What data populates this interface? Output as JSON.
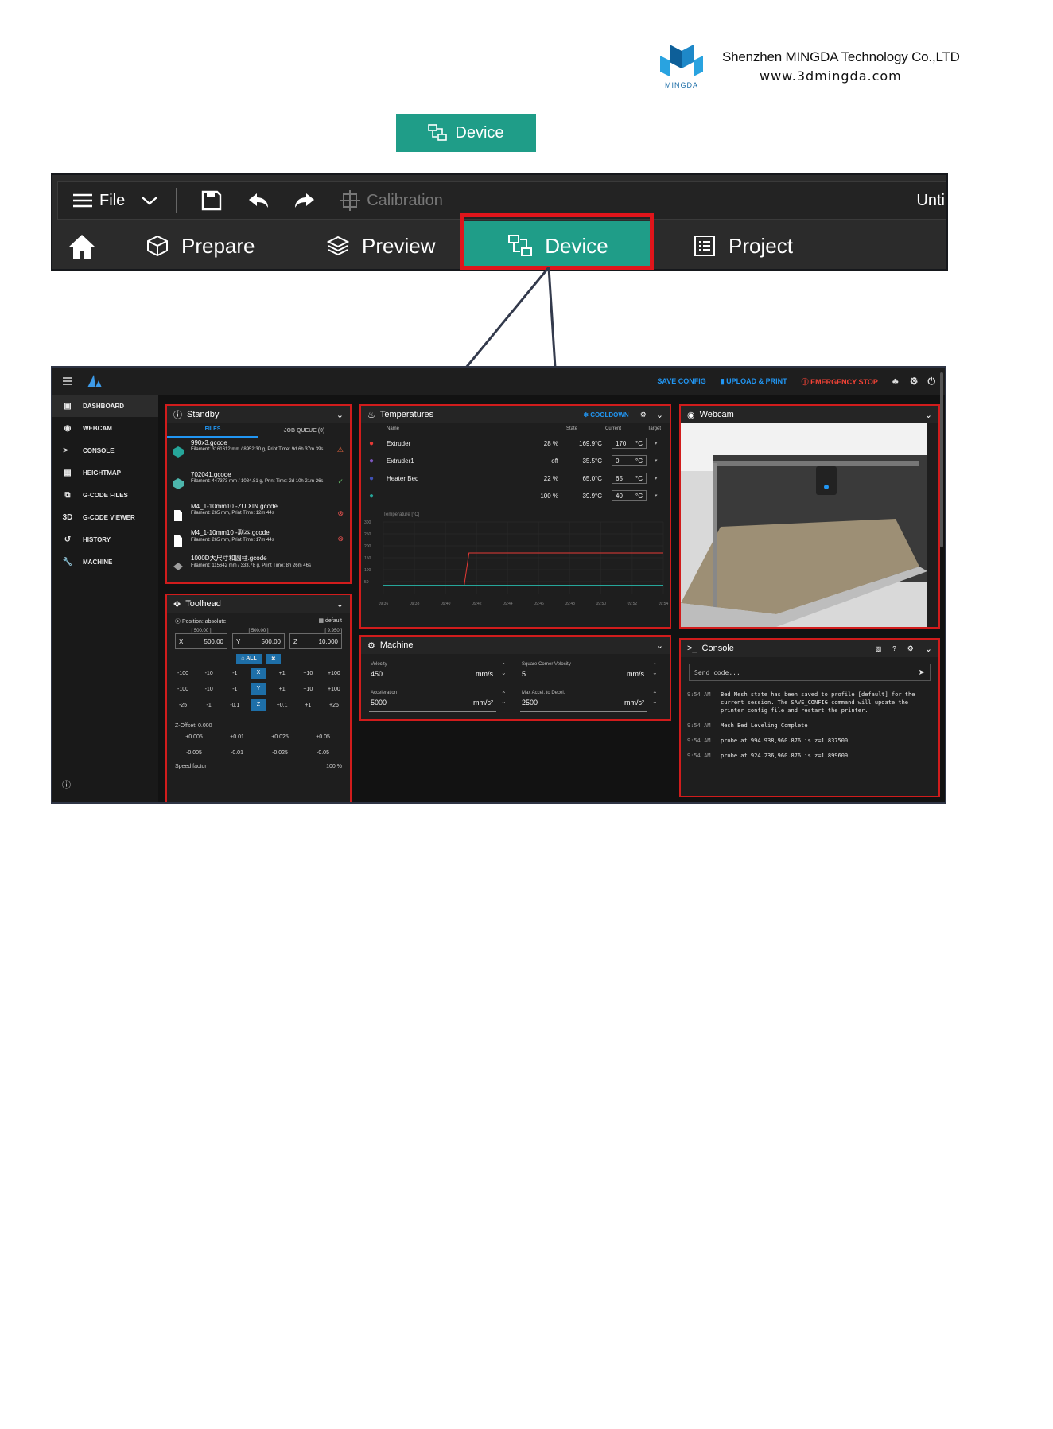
{
  "header": {
    "company_name": "Shenzhen MINGDA Technology Co.,LTD",
    "website": "www.3dmingda.com",
    "logo_text": "MINGDA"
  },
  "device_chip": {
    "label": "Device"
  },
  "toolbar": {
    "file_label": "File",
    "calibration_label": "Calibration",
    "title_fragment": "Unti",
    "tabs": [
      {
        "label": "Prepare"
      },
      {
        "label": "Preview"
      },
      {
        "label": "Device"
      },
      {
        "label": "Project"
      }
    ]
  },
  "mainsail": {
    "topbar": {
      "save_config": "SAVE CONFIG",
      "upload_print": "UPLOAD & PRINT",
      "emergency_stop": "EMERGENCY STOP"
    },
    "sidebar": [
      {
        "label": "DASHBOARD",
        "icon": "dashboard-icon"
      },
      {
        "label": "WEBCAM",
        "icon": "webcam-icon"
      },
      {
        "label": "CONSOLE",
        "icon": "console-icon"
      },
      {
        "label": "HEIGHTMAP",
        "icon": "grid-icon"
      },
      {
        "label": "G-CODE FILES",
        "icon": "files-icon"
      },
      {
        "label": "G-CODE VIEWER",
        "icon": "3d-icon"
      },
      {
        "label": "HISTORY",
        "icon": "history-icon"
      },
      {
        "label": "MACHINE",
        "icon": "wrench-icon"
      }
    ],
    "standby": {
      "title": "Standby",
      "tab_files": "FILES",
      "tab_queue": "JOB QUEUE (0)",
      "files": [
        {
          "name": "990x3.gcode",
          "meta": "Filament: 3161612 mm / 8952.30 g, Print Time: 9d 6h 37m 39s",
          "status": "warning"
        },
        {
          "name": "702041.gcode",
          "meta": "Filament: 447373 mm / 1084.81 g, Print Time: 2d 10h 21m 26s",
          "status": "ok"
        },
        {
          "name": "M4_1-10mm10 -ZUIXIN.gcode",
          "meta": "Filament: 265 mm, Print Time: 12m 44s",
          "status": "error"
        },
        {
          "name": "M4_1-10mm10 -副本.gcode",
          "meta": "Filament: 265 mm, Print Time: 17m 44s",
          "status": "error"
        },
        {
          "name": "1000D大尺寸和圆柱.gcode",
          "meta": "Filament: 115642 mm / 333.78 g, Print Time: 8h 26m 46s",
          "status": ""
        }
      ]
    },
    "toolhead": {
      "title": "Toolhead",
      "position_label": "Position: absolute",
      "default_label": "default",
      "x": {
        "label": "X",
        "value": "500.00",
        "max": "[ 500.00 ]"
      },
      "y": {
        "label": "Y",
        "value": "500.00",
        "max": "[ 500.00 ]"
      },
      "z": {
        "label": "Z",
        "value": "10.000",
        "max": "[ 9.950 ]"
      },
      "home_all": "ALL",
      "jog_x": [
        "-100",
        "-10",
        "-1",
        "X",
        "+1",
        "+10",
        "+100"
      ],
      "jog_y": [
        "-100",
        "-10",
        "-1",
        "Y",
        "+1",
        "+10",
        "+100"
      ],
      "jog_z": [
        "-25",
        "-1",
        "-0.1",
        "Z",
        "+0.1",
        "+1",
        "+25"
      ],
      "zoffset_label": "Z-Offset: 0.000",
      "zoffset_up": [
        "+0.005",
        "+0.01",
        "+0.025",
        "+0.05"
      ],
      "zoffset_down": [
        "-0.005",
        "-0.01",
        "-0.025",
        "-0.05"
      ],
      "speed_factor_label": "Speed factor",
      "speed_factor_value": "100",
      "speed_factor_unit": "%"
    },
    "temperatures": {
      "title": "Temperatures",
      "cooldown": "COOLDOWN",
      "headers": [
        "Name",
        "State",
        "Current",
        "Target"
      ],
      "rows": [
        {
          "name": "Extruder",
          "state": "28 %",
          "current": "169.9°C",
          "target": "170",
          "unit": "°C",
          "icon_color": "#e53935"
        },
        {
          "name": "Extruder1",
          "state": "off",
          "current": "35.5°C",
          "target": "0",
          "unit": "°C",
          "icon_color": "#7e57c2"
        },
        {
          "name": "Heater Bed",
          "state": "22 %",
          "current": "65.0°C",
          "target": "65",
          "unit": "°C",
          "icon_color": "#3f51b5"
        },
        {
          "name": "",
          "state": "100 %",
          "current": "39.9°C",
          "target": "40",
          "unit": "°C",
          "icon_color": "#26a69a"
        }
      ],
      "chart_label": "Temperature [°C]",
      "y_ticks": [
        "300",
        "250",
        "200",
        "150",
        "100",
        "50"
      ],
      "x_ticks": [
        "09:36",
        "09:38",
        "09:40",
        "09:42",
        "09:44",
        "09:46",
        "09:48",
        "09:50",
        "09:52",
        "09:54"
      ]
    },
    "webcam": {
      "title": "Webcam"
    },
    "machine": {
      "title": "Machine",
      "fields": [
        {
          "label": "Velocity",
          "value": "450",
          "unit": "mm/s"
        },
        {
          "label": "Square Corner Velocity",
          "value": "5",
          "unit": "mm/s"
        },
        {
          "label": "Acceleration",
          "value": "5000",
          "unit": "mm/s²"
        },
        {
          "label": "Max Accel. to Decel.",
          "value": "2500",
          "unit": "mm/s²"
        }
      ]
    },
    "console": {
      "title": "Console",
      "placeholder": "Send code...",
      "lines": [
        {
          "time": "9:54 AM",
          "text": "Bed Mesh state has been saved to profile [default] for the current session. The SAVE_CONFIG command will update the printer config file and restart the printer."
        },
        {
          "time": "9:54 AM",
          "text": "Mesh Bed Leveling Complete"
        },
        {
          "time": "9:54 AM",
          "text": "probe at 994.938,960.876 is z=1.837500"
        },
        {
          "time": "9:54 AM",
          "text": "probe at 924.236,960.876 is z=1.899609"
        }
      ]
    }
  },
  "chart_data": {
    "type": "line",
    "title": "Temperature [°C]",
    "x": [
      "09:36",
      "09:38",
      "09:40",
      "09:42",
      "09:44",
      "09:46",
      "09:48",
      "09:50",
      "09:52",
      "09:54"
    ],
    "ylim": [
      0,
      300
    ],
    "series": [
      {
        "name": "Extruder",
        "values": [
          35,
          35,
          35,
          170,
          170,
          170,
          170,
          170,
          170,
          170
        ]
      },
      {
        "name": "Heater Bed",
        "values": [
          65,
          65,
          65,
          65,
          65,
          65,
          65,
          65,
          65,
          65
        ]
      },
      {
        "name": "Extruder1",
        "values": [
          35,
          35,
          35,
          35,
          35,
          35,
          35,
          35,
          35,
          35
        ]
      }
    ]
  }
}
